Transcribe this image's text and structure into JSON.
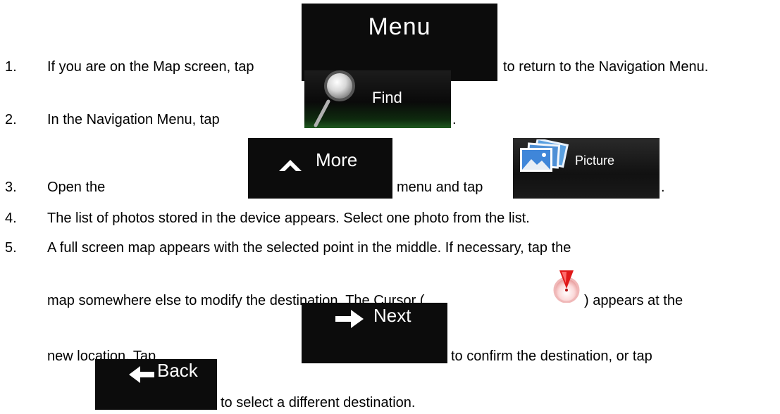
{
  "steps": [
    {
      "num": "1.",
      "before": "If you are on the Map screen, tap",
      "after": "to return to the Navigation Menu."
    },
    {
      "num": "2.",
      "before": "In the Navigation Menu, tap",
      "after": "."
    },
    {
      "num": "3.",
      "before": "Open the",
      "middle": "menu and tap",
      "after": "."
    },
    {
      "num": "4.",
      "text": "The list of photos stored in the device appears. Select one photo from the list."
    },
    {
      "num": "5.",
      "line1": "A full screen map appears with the selected point in the middle. If necessary, tap the",
      "line2a": "map somewhere else to modify the destination. The Cursor (",
      "line2b": ") appears at the",
      "line3a": "new location. Tap",
      "line3b": "to confirm the destination, or tap",
      "line4": "to select a different destination."
    }
  ],
  "buttons": {
    "menu": "Menu",
    "find": "Find",
    "more": "More",
    "picture": "Picture",
    "next": "Next",
    "back": "Back"
  },
  "icons": {
    "find": "magnifier-icon",
    "more": "chevron-up-icon",
    "picture": "photos-icon",
    "next": "arrow-right-icon",
    "back": "arrow-left-icon",
    "cursor": "map-cursor-icon"
  }
}
